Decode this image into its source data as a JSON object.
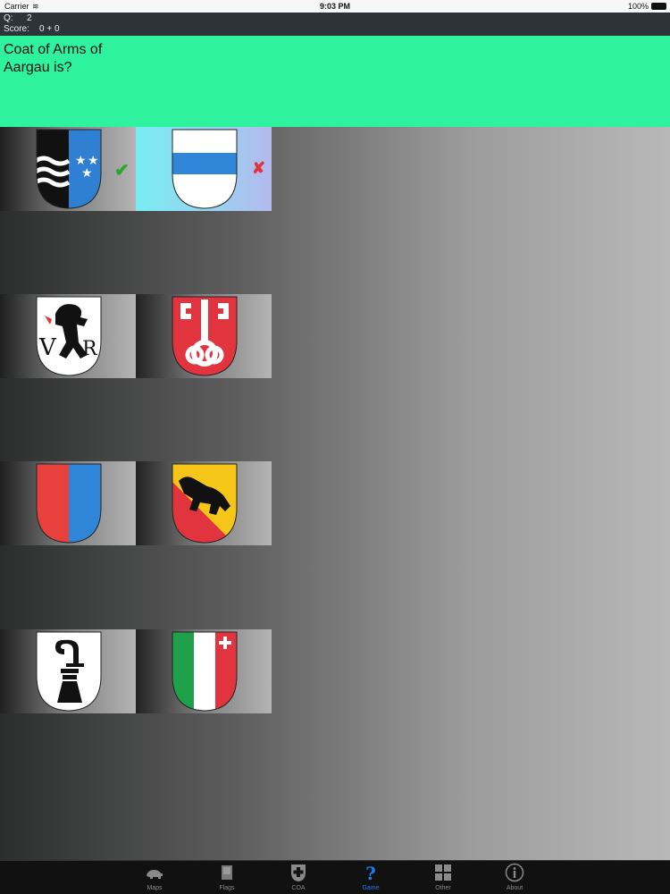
{
  "status_bar": {
    "carrier": "Carrier",
    "wifi_icon": "wifi-icon",
    "time": "9:03 PM",
    "battery": "100%"
  },
  "info": {
    "q_label": "Q:",
    "q_value": "2",
    "score_label": "Score:",
    "score_value": "0 + 0"
  },
  "question": {
    "text": "Coat of Arms of Aargau is?",
    "background_color": "#2ff29f"
  },
  "answers": [
    {
      "name": "aargau-coat-of-arms",
      "mark": "✔",
      "mark_type": "correct"
    },
    {
      "name": "zug-coat-of-arms",
      "mark": "✘",
      "mark_type": "wrong",
      "selected": true
    },
    {
      "name": "appenzell-ausserrhoden-coat-of-arms",
      "mark": ""
    },
    {
      "name": "nidwalden-coat-of-arms",
      "mark": ""
    },
    {
      "name": "ticino-coat-of-arms",
      "mark": ""
    },
    {
      "name": "bern-coat-of-arms",
      "mark": ""
    },
    {
      "name": "basel-landschaft-coat-of-arms",
      "mark": ""
    },
    {
      "name": "neuchatel-coat-of-arms",
      "mark": ""
    }
  ],
  "tabs": [
    {
      "label": "Maps",
      "icon": "bear-icon"
    },
    {
      "label": "Flags",
      "icon": "flag-icon"
    },
    {
      "label": "COA",
      "icon": "shield-cross-icon"
    },
    {
      "label": "Game",
      "icon": "question-icon",
      "active": true
    },
    {
      "label": "Other",
      "icon": "grid-icon"
    },
    {
      "label": "About",
      "icon": "info-icon"
    }
  ],
  "colors": {
    "accent": "#1e7cf2",
    "correct": "#2ea62a",
    "wrong": "#e1343f"
  }
}
